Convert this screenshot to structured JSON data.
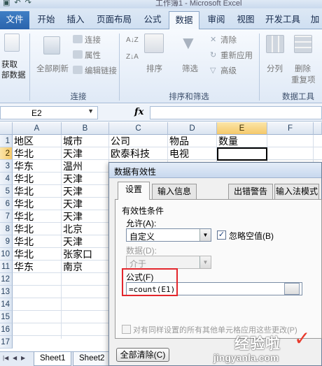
{
  "window": {
    "title": "工作簿1 - Microsoft Excel"
  },
  "ribbon_tabs": [
    "文件",
    "开始",
    "插入",
    "页面布局",
    "公式",
    "数据",
    "审阅",
    "视图",
    "开发工具",
    "加"
  ],
  "ribbon": {
    "get_external": "获取\n部数据",
    "refresh_all": "全部刷新",
    "connections": "连接",
    "properties": "属性",
    "edit_links": "编辑链接",
    "sort": "排序",
    "filter": "筛选",
    "clear": "清除",
    "reapply": "重新应用",
    "advanced": "高级",
    "split_column": "分列",
    "remove_dup": "删除",
    "dup_item": "重复项",
    "group_connections": "连接",
    "group_sort_filter": "排序和筛选",
    "group_data_tools": "数据工具",
    "sort_az": "A↓Z",
    "sort_za": "Z↓A"
  },
  "formula_bar": {
    "name_box": "E2",
    "fx": "fx",
    "formula": ""
  },
  "grid": {
    "columns": [
      "A",
      "B",
      "C",
      "D",
      "E",
      "F"
    ],
    "rows": [
      "1",
      "2",
      "3",
      "4",
      "5",
      "6",
      "7",
      "8",
      "9",
      "10",
      "11",
      "12",
      "13",
      "14",
      "15",
      "16",
      "17"
    ],
    "cells": [
      [
        "地区",
        "城市",
        "公司",
        "物品",
        "数量"
      ],
      [
        "华北",
        "天津",
        "欧泰科技",
        "电视",
        ""
      ],
      [
        "华东",
        "温州",
        "",
        "",
        ""
      ],
      [
        "华北",
        "天津",
        "",
        "",
        ""
      ],
      [
        "华北",
        "天津",
        "",
        "",
        ""
      ],
      [
        "华北",
        "天津",
        "",
        "",
        ""
      ],
      [
        "华北",
        "天津",
        "",
        "",
        ""
      ],
      [
        "华北",
        "北京",
        "",
        "",
        ""
      ],
      [
        "华北",
        "天津",
        "",
        "",
        ""
      ],
      [
        "华北",
        "张家口",
        "",
        "",
        ""
      ],
      [
        "华东",
        "南京",
        "",
        "",
        ""
      ]
    ],
    "selected_cell": "E2"
  },
  "sheet_tabs": [
    "Sheet1",
    "Sheet2"
  ],
  "dialog": {
    "title": "数据有效性",
    "tabs": [
      "设置",
      "输入信息",
      "出错警告",
      "输入法模式"
    ],
    "criteria_label": "有效性条件",
    "allow_label": "允许(A):",
    "allow_value": "自定义",
    "ignore_blank_label": "忽略空值(B)",
    "ignore_blank_checked": true,
    "data_label": "数据(D):",
    "data_value": "介于",
    "formula_label": "公式(F)",
    "formula_value": "=count(E1)",
    "apply_all_label": "对有同样设置的所有其他单元格应用这些更改(P)",
    "clear_all_button": "全部清除(C)"
  },
  "watermark": {
    "line1": "经验啦",
    "line2": "jingyanla.com",
    "check": "✓"
  }
}
